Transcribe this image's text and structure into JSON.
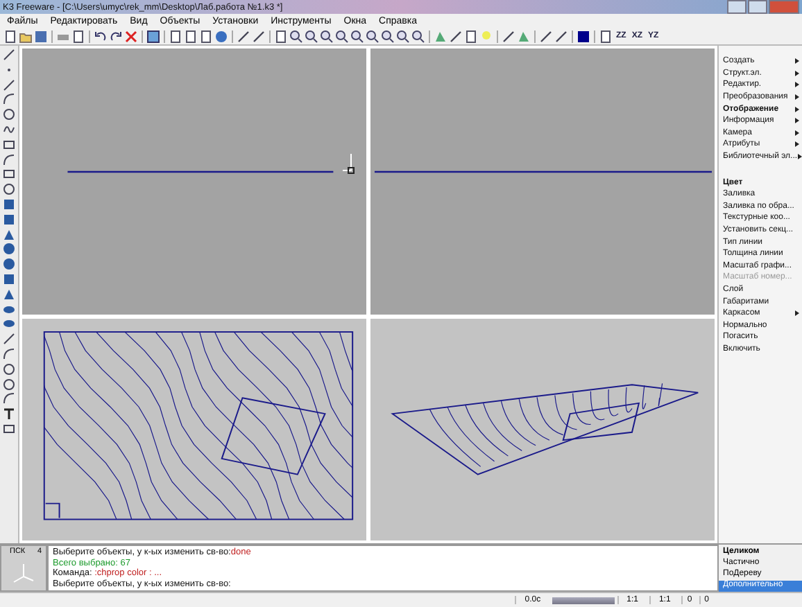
{
  "window": {
    "title": "K3 Freeware - [C:\\Users\\umyc\\rek_mm\\Desktop\\Лаб.работа №1.k3 *]"
  },
  "menu": [
    "Файлы",
    "Редактировать",
    "Вид",
    "Объекты",
    "Установки",
    "Инструменты",
    "Окна",
    "Справка"
  ],
  "toolbar": {
    "view_labels": [
      "ZZ",
      "XZ",
      "YZ"
    ]
  },
  "side_menu": [
    {
      "label": "Создать",
      "kind": "submenu",
      "bold": false,
      "disabled": false
    },
    {
      "label": "Структ.эл.",
      "kind": "submenu",
      "bold": false,
      "disabled": false
    },
    {
      "label": "Редактир.",
      "kind": "submenu",
      "bold": false,
      "disabled": false
    },
    {
      "label": "Преобразования",
      "kind": "submenu",
      "bold": false,
      "disabled": false
    },
    {
      "label": "Отображение",
      "kind": "submenu",
      "bold": true,
      "disabled": false
    },
    {
      "label": "Информация",
      "kind": "submenu",
      "bold": false,
      "disabled": false
    },
    {
      "label": "Камера",
      "kind": "submenu",
      "bold": false,
      "disabled": false
    },
    {
      "label": "Атрибуты",
      "kind": "submenu",
      "bold": false,
      "disabled": false
    },
    {
      "label": "Библиотечный эл...",
      "kind": "submenu",
      "bold": false,
      "disabled": false
    },
    {
      "kind": "separator"
    },
    {
      "label": "Цвет",
      "kind": "command",
      "bold": true,
      "disabled": false
    },
    {
      "label": "Заливка",
      "kind": "command",
      "bold": false,
      "disabled": false
    },
    {
      "label": "Заливка по обра...",
      "kind": "command",
      "bold": false,
      "disabled": false
    },
    {
      "label": "Текстурные коо...",
      "kind": "command",
      "bold": false,
      "disabled": false
    },
    {
      "label": "Установить секц...",
      "kind": "command",
      "bold": false,
      "disabled": false
    },
    {
      "label": "Тип линии",
      "kind": "command",
      "bold": false,
      "disabled": false
    },
    {
      "label": "Толщина линии",
      "kind": "command",
      "bold": false,
      "disabled": false
    },
    {
      "label": "Масштаб графи...",
      "kind": "command",
      "bold": false,
      "disabled": false
    },
    {
      "label": "Масштаб номер...",
      "kind": "command",
      "bold": false,
      "disabled": true
    },
    {
      "label": "Слой",
      "kind": "command",
      "bold": false,
      "disabled": false
    },
    {
      "label": "Габаритами",
      "kind": "command",
      "bold": false,
      "disabled": false
    },
    {
      "label": "Каркасом",
      "kind": "submenu",
      "bold": false,
      "disabled": false
    },
    {
      "label": "Нормально",
      "kind": "command",
      "bold": false,
      "disabled": false
    },
    {
      "label": "Погасить",
      "kind": "command",
      "bold": false,
      "disabled": false
    },
    {
      "label": "Включить",
      "kind": "command",
      "bold": false,
      "disabled": false
    }
  ],
  "console": {
    "cs_label": "ПСК",
    "cs_number": "4",
    "lines": [
      [
        {
          "text": "Выберите объекты, у к-ых изменить св-во:",
          "kind": "normal"
        },
        {
          "text": "done",
          "kind": "input"
        }
      ],
      [
        {
          "text": "Всего выбрано: 67",
          "kind": "info"
        }
      ],
      [
        {
          "text": "Команда: ",
          "kind": "normal"
        },
        {
          "text": ":chprop color : ...",
          "kind": "input"
        }
      ],
      [
        {
          "text": "Выберите объекты, у к-ых изменить св-во:",
          "kind": "prompt"
        }
      ]
    ]
  },
  "select_modes": [
    {
      "label": "Целиком",
      "bold": true,
      "selected": false
    },
    {
      "label": "Частично",
      "bold": false,
      "selected": false
    },
    {
      "label": "ПоДереву",
      "bold": false,
      "selected": false
    },
    {
      "label": "Дополнительно",
      "bold": false,
      "selected": true
    }
  ],
  "status_bar": {
    "time": "0.0c",
    "progress": {
      "level": 1
    },
    "scale_1": "1:1",
    "scale_2": "1:1",
    "count_1": "0",
    "count_2": "0"
  }
}
